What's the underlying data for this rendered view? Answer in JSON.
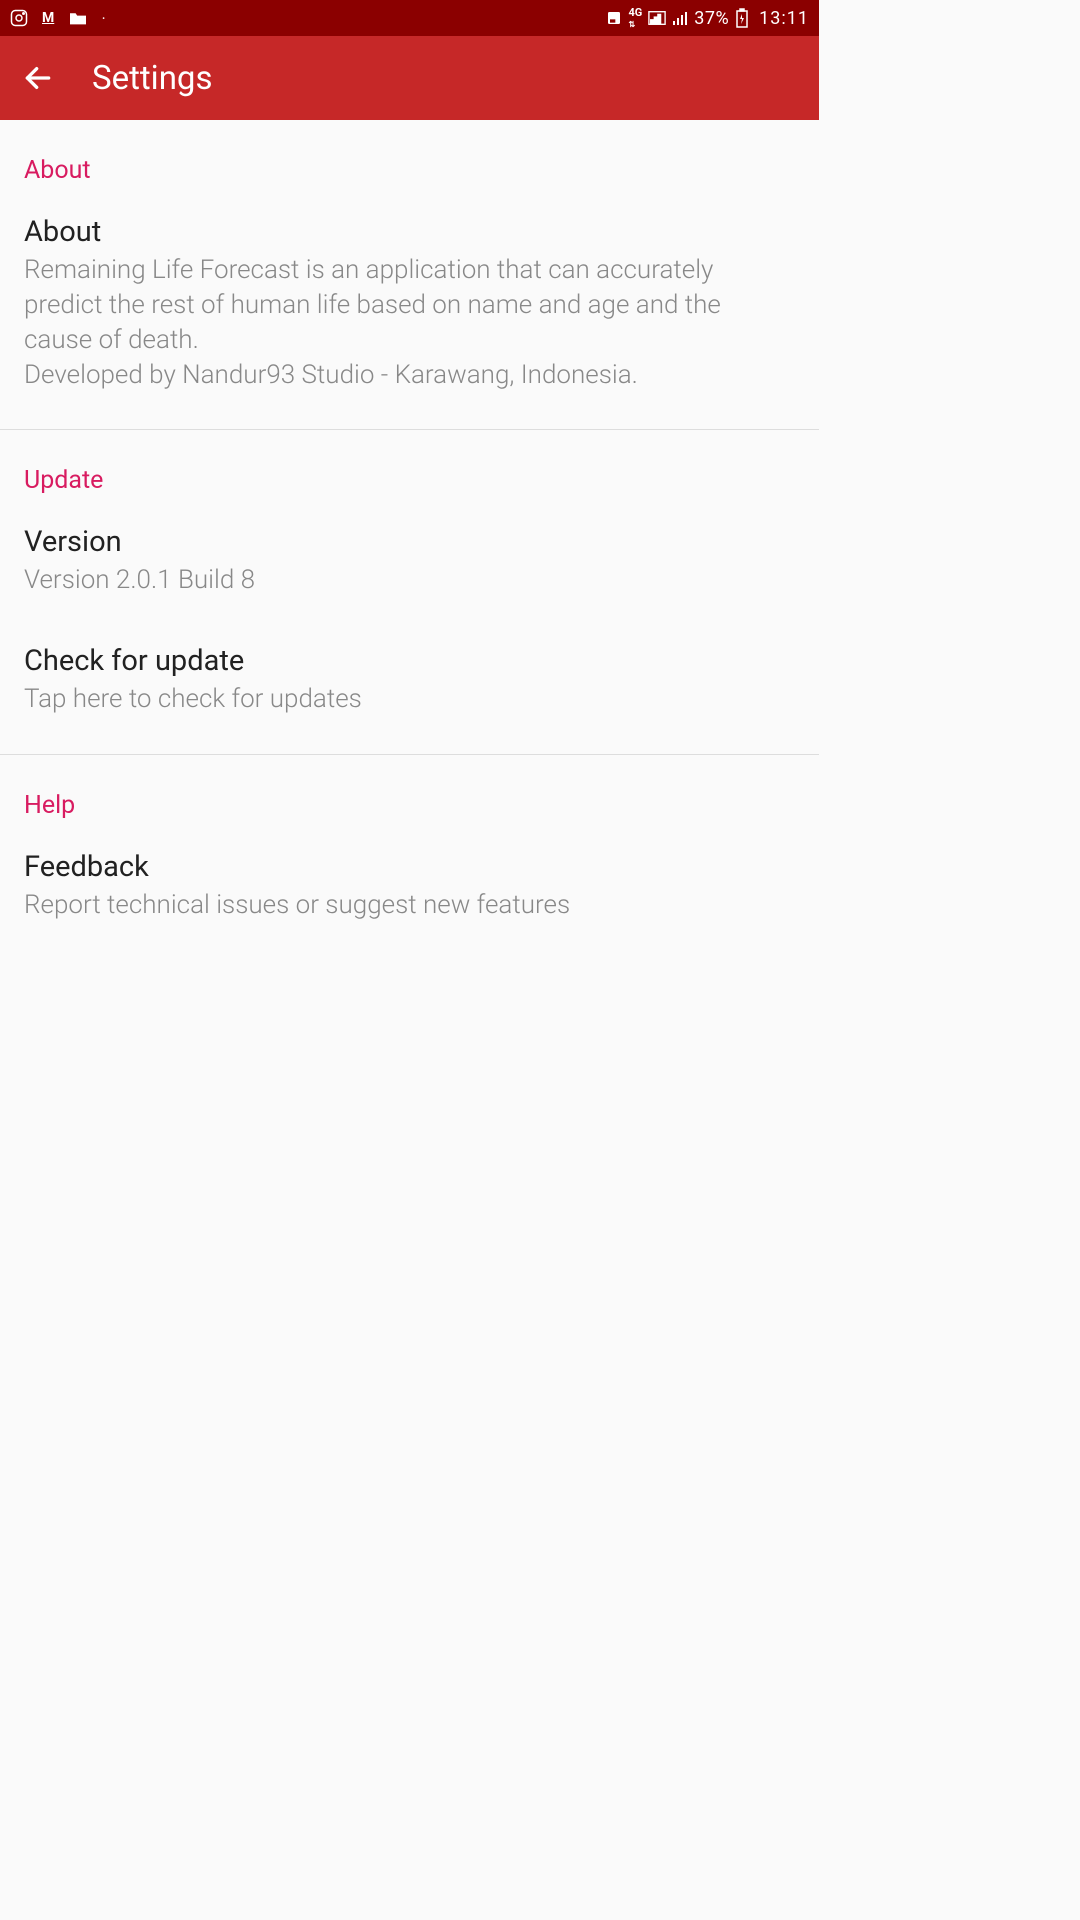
{
  "status": {
    "battery": "37%",
    "time": "13:11",
    "network": "4G"
  },
  "appbar": {
    "title": "Settings"
  },
  "sections": {
    "about": {
      "header": "About",
      "item": {
        "title": "About",
        "desc": "Remaining Life Forecast is an application that can accurately predict the rest of human life based on name and age and the cause of death.\nDeveloped by Nandur93 Studio - Karawang, Indonesia."
      }
    },
    "update": {
      "header": "Update",
      "version": {
        "title": "Version",
        "desc": "Version 2.0.1 Build 8"
      },
      "check": {
        "title": "Check for update",
        "desc": "Tap here to check for updates"
      }
    },
    "help": {
      "header": "Help",
      "feedback": {
        "title": "Feedback",
        "desc": "Report technical issues or suggest new features"
      }
    }
  }
}
